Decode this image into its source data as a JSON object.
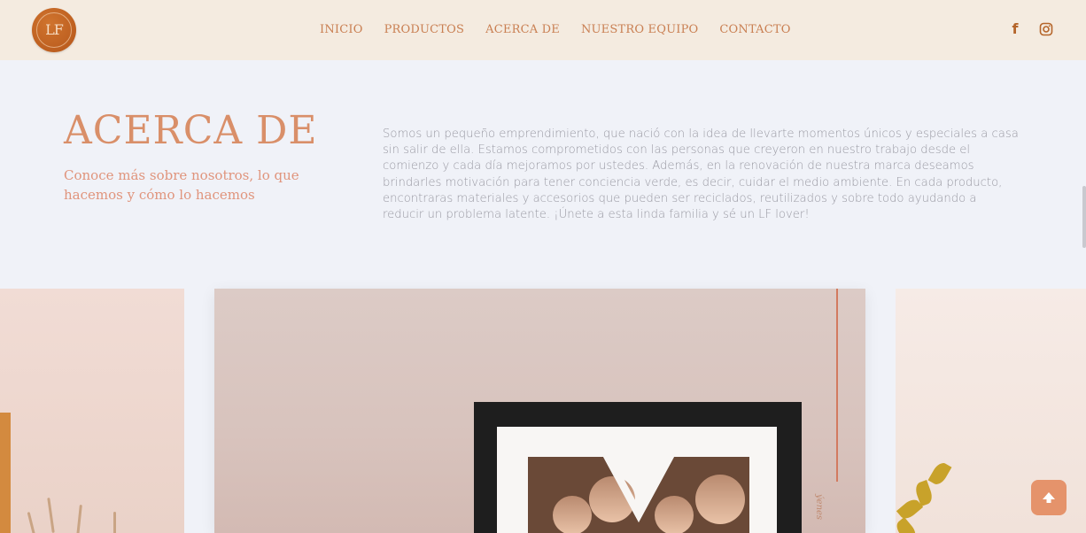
{
  "brand": {
    "logo_text": "LF"
  },
  "nav": {
    "items": [
      {
        "label": "INICIO"
      },
      {
        "label": "PRODUCTOS"
      },
      {
        "label": "ACERCA DE"
      },
      {
        "label": "NUESTRO EQUIPO"
      },
      {
        "label": "CONTACTO"
      }
    ]
  },
  "social": {
    "facebook_glyph": "f",
    "icons": [
      "facebook-icon",
      "instagram-icon"
    ]
  },
  "about": {
    "title": "ACERCA DE",
    "subtitle": "Conoce más sobre nosotros, lo que hacemos y cómo lo hacemos",
    "body": "Somos un pequeño emprendimiento, que nació con la idea de llevarte momentos únicos y especiales a casa sin salir de ella. Estamos comprometidos con las personas que creyeron en nuestro trabajo desde el comienzo y cada día mejoramos por ustedes. Además, en la renovación de nuestra marca deseamos brindarles motivación para tener conciencia verde, es decir, cuidar el medio ambiente. En cada producto, encontraras materiales y accesorios que pueden ser reciclados, reutilizados y sobre todo ayudando a reducir un problema latente. ¡Únete a esta linda familia y sé un LF lover!"
  },
  "carousel": {
    "card_caption": "ýenes"
  },
  "colors": {
    "navbar_bg": "#f4ebe0",
    "page_bg": "#f0f2f8",
    "accent": "#c97f52",
    "title": "#d98f69",
    "scroll_button": "#e5936b"
  },
  "scroll_top": {
    "icon": "arrow-up-icon"
  }
}
